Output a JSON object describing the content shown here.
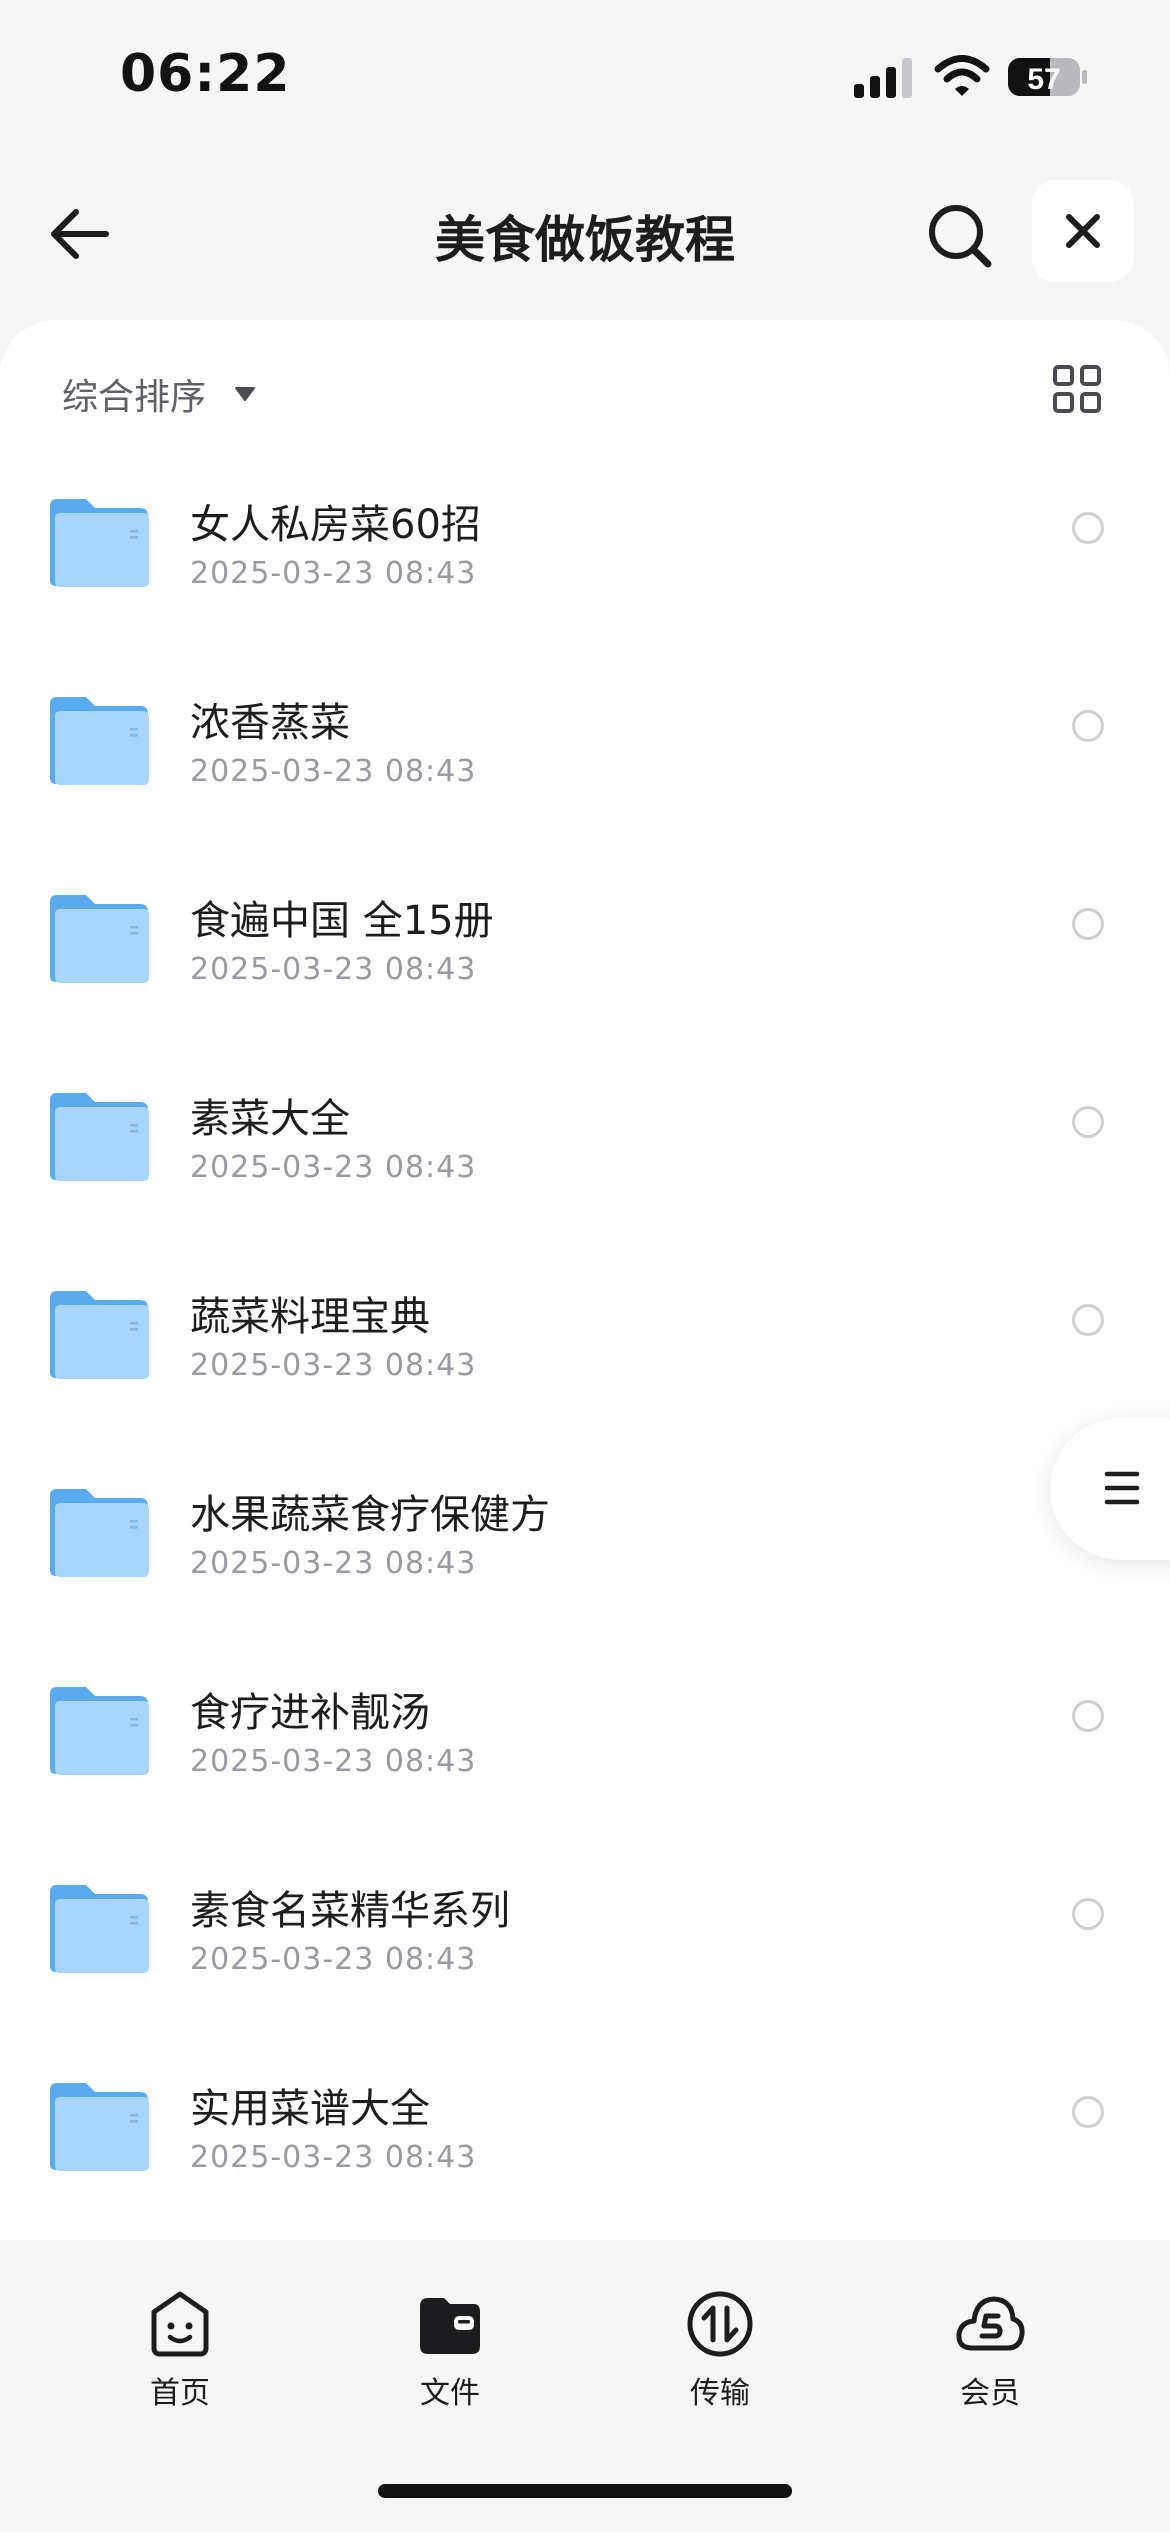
{
  "status_bar": {
    "time": "06:22",
    "battery_level": "57"
  },
  "header": {
    "title": "美食做饭教程",
    "back_icon": "arrow-left-icon",
    "search_icon": "search-icon",
    "close_icon": "close-icon"
  },
  "toolbar": {
    "sort_label": "综合排序",
    "view_toggle_icon": "grid-view-icon"
  },
  "files": [
    {
      "name": "女人私房菜60招",
      "date": "2025-03-23 08:43"
    },
    {
      "name": "浓香蒸菜",
      "date": "2025-03-23 08:43"
    },
    {
      "name": "食遍中国 全15册",
      "date": "2025-03-23 08:43"
    },
    {
      "name": "素菜大全",
      "date": "2025-03-23 08:43"
    },
    {
      "name": "蔬菜料理宝典",
      "date": "2025-03-23 08:43"
    },
    {
      "name": "水果蔬菜食疗保健方",
      "date": "2025-03-23 08:43"
    },
    {
      "name": "食疗进补靓汤",
      "date": "2025-03-23 08:43"
    },
    {
      "name": "素食名菜精华系列",
      "date": "2025-03-23 08:43"
    },
    {
      "name": "实用菜谱大全",
      "date": "2025-03-23 08:43"
    }
  ],
  "tabs": [
    {
      "label": "首页",
      "icon": "home-face-icon"
    },
    {
      "label": "文件",
      "icon": "files-icon"
    },
    {
      "label": "传输",
      "icon": "transfer-icon"
    },
    {
      "label": "会员",
      "icon": "vip-cloud-icon"
    }
  ],
  "colors": {
    "folder_blue": "#5aaaf0",
    "folder_light": "#a9d4fb",
    "background": "#f6f6f7",
    "sheet": "#ffffff"
  }
}
